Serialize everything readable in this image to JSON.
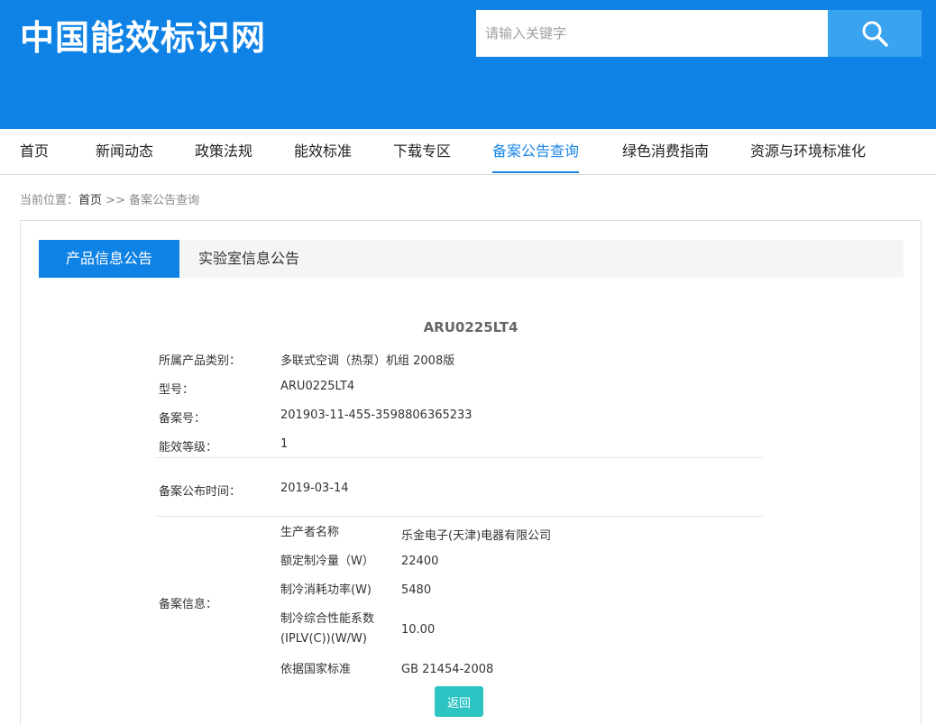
{
  "header": {
    "logo_text": "中国能效标识网",
    "search_placeholder": "请输入关键字",
    "search_icon": "search-icon",
    "bg_color": "#0f82e6"
  },
  "nav": {
    "items": [
      {
        "label": "首页"
      },
      {
        "label": "新闻动态"
      },
      {
        "label": "政策法规"
      },
      {
        "label": "能效标准"
      },
      {
        "label": "下载专区"
      },
      {
        "label": "备案公告查询"
      },
      {
        "label": "绿色消费指南"
      },
      {
        "label": "资源与环境标准化"
      }
    ],
    "active_index": 5,
    "active_color": "#1a86e6"
  },
  "breadcrumb": {
    "prefix": "当前位置：",
    "home": "首页",
    "separator": ">>",
    "current": "备案公告查询"
  },
  "tabs": [
    {
      "label": "产品信息公告",
      "active": true
    },
    {
      "label": "实验室信息公告",
      "active": false
    }
  ],
  "record": {
    "title": "ARU0225LT4",
    "fields": [
      {
        "label": "所属产品类别：",
        "value": "多联式空调（热泵）机组 2008版"
      },
      {
        "label": "型号：",
        "value": "ARU0225LT4"
      },
      {
        "label": "备案号：",
        "value": "201903-11-455-3598806365233"
      },
      {
        "label": "能效等级：",
        "value": "1"
      }
    ],
    "publish": {
      "label": "备案公布时间：",
      "value": "2019-03-14"
    },
    "info": {
      "label": "备案信息：",
      "rows": [
        {
          "label": "生产者名称",
          "value": "乐金电子(天津)电器有限公司"
        },
        {
          "label": "额定制冷量（W）",
          "value": "22400"
        },
        {
          "label": "制冷消耗功率(W)",
          "value": "5480"
        },
        {
          "label": "制冷综合性能系数(IPLV(C))(W/W)",
          "value": "10.00"
        },
        {
          "label": "依据国家标准",
          "value": "GB 21454-2008"
        }
      ]
    }
  },
  "back_button": {
    "label": "返回",
    "color": "#2ec4c4"
  }
}
